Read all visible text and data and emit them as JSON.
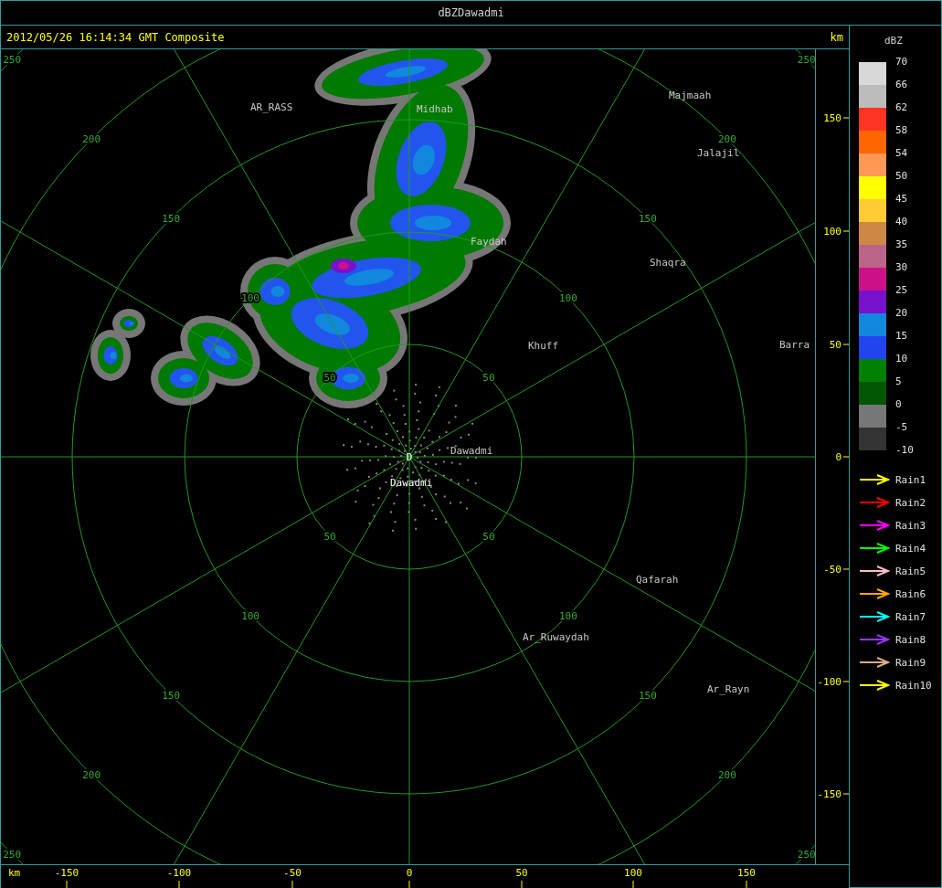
{
  "window": {
    "title": "dBZDawadmi"
  },
  "header": {
    "timestamp": "2012/05/26 16:14:34 GMT Composite",
    "unit": "km"
  },
  "range_rings": [
    {
      "labels": [
        "50",
        "50",
        "50",
        "50"
      ]
    },
    {
      "labels": [
        "100",
        "100",
        "100",
        "100"
      ]
    },
    {
      "labels": [
        "150",
        "150",
        "150",
        "150"
      ]
    },
    {
      "labels": [
        "200",
        "200",
        "200",
        "200"
      ]
    },
    {
      "labels": [
        "250",
        "250",
        "250",
        "250"
      ]
    }
  ],
  "radar_site": {
    "marker": "D",
    "name": "Dawadmi"
  },
  "cities": [
    {
      "name": "AR_RASS"
    },
    {
      "name": "Midhab"
    },
    {
      "name": "Majmaah"
    },
    {
      "name": "Jalajil"
    },
    {
      "name": "Faydah"
    },
    {
      "name": "Shaqra"
    },
    {
      "name": "Barra"
    },
    {
      "name": "Khuff"
    },
    {
      "name": "Dawadmi"
    },
    {
      "name": "Qafarah"
    },
    {
      "name": "Ar_Ruwaydah"
    },
    {
      "name": "Ar_Rayn"
    }
  ],
  "y_axis": {
    "ticks": [
      "150",
      "100",
      "50",
      "0",
      "-50",
      "-100",
      "-150"
    ]
  },
  "x_axis": {
    "unit": "km",
    "ticks": [
      "-150",
      "-100",
      "-50",
      "0",
      "50",
      "100",
      "150"
    ]
  },
  "legend": {
    "title": "dBZ",
    "bands": [
      {
        "label": "70",
        "color": "#d8d8d8"
      },
      {
        "label": "66",
        "color": "#bcbcbc"
      },
      {
        "label": "62",
        "color": "#ff3322"
      },
      {
        "label": "58",
        "color": "#ff6600"
      },
      {
        "label": "54",
        "color": "#ff9955"
      },
      {
        "label": "50",
        "color": "#ffff00"
      },
      {
        "label": "45",
        "color": "#ffcc33"
      },
      {
        "label": "40",
        "color": "#cc8844"
      },
      {
        "label": "35",
        "color": "#bb6688"
      },
      {
        "label": "30",
        "color": "#cc1188"
      },
      {
        "label": "25",
        "color": "#7711cc"
      },
      {
        "label": "20",
        "color": "#1188dd"
      },
      {
        "label": "15",
        "color": "#2244ee"
      },
      {
        "label": "10",
        "color": "#008000"
      },
      {
        "label": "5",
        "color": "#005500"
      },
      {
        "label": "0",
        "color": "#777777"
      },
      {
        "label": "-5",
        "color": "#333333"
      }
    ],
    "bottom_label": "-10"
  },
  "tracks": [
    {
      "label": "Rain1",
      "color": "#ffff00"
    },
    {
      "label": "Rain2",
      "color": "#ff0000"
    },
    {
      "label": "Rain3",
      "color": "#ff00ff"
    },
    {
      "label": "Rain4",
      "color": "#00ff00"
    },
    {
      "label": "Rain5",
      "color": "#ffbbcc"
    },
    {
      "label": "Rain6",
      "color": "#ffaa00"
    },
    {
      "label": "Rain7",
      "color": "#00ffff"
    },
    {
      "label": "Rain8",
      "color": "#9933ff"
    },
    {
      "label": "Rain9",
      "color": "#ddaa88"
    },
    {
      "label": "Rain10",
      "color": "#ffff00"
    }
  ]
}
